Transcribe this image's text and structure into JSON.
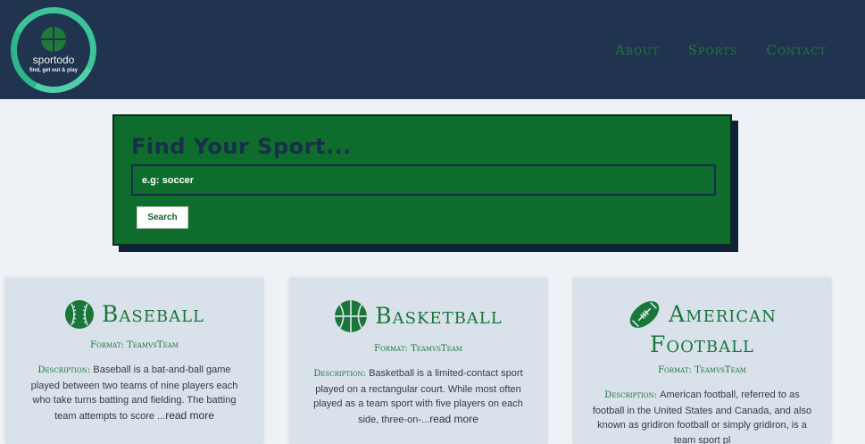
{
  "brand": {
    "name": "sportodo",
    "tagline": "find, get out & play",
    "accent": "#3cc39a",
    "header_color": "#21344f"
  },
  "nav": {
    "items": [
      {
        "label": "About"
      },
      {
        "label": "Sports"
      },
      {
        "label": "Contact"
      }
    ]
  },
  "search": {
    "title": "Find Your Sport...",
    "placeholder": "e.g: soccer",
    "value": "",
    "button_label": "Search",
    "panel_color": "#0e6d2c"
  },
  "cards": [
    {
      "icon": "baseball-icon",
      "title": "Baseball",
      "format_label": "Format: ",
      "format_value": "TeamvsTeam",
      "desc_label": "Description: ",
      "desc_text": "Baseball is a bat-and-ball game played between two teams of nine players each who take turns batting and fielding. The batting team attempts to score ...",
      "read_more": "read more"
    },
    {
      "icon": "basketball-icon",
      "title": "Basketball",
      "format_label": "Format: ",
      "format_value": "TeamvsTeam",
      "desc_label": "Description: ",
      "desc_text": "Basketball is a limited-contact sport played on a rectangular court. While most often played as a team sport with five players on each side, three-on-...",
      "read_more": "read more"
    },
    {
      "icon": "american-football-icon",
      "title_line1": "American",
      "title_line2": "Football",
      "format_label": "Format: ",
      "format_value": "TeamvsTeam",
      "desc_label": "Description: ",
      "desc_text": "American football, referred to as football in the United States and Canada, and also known as gridiron football or simply gridiron, is a team sport pl"
    }
  ]
}
